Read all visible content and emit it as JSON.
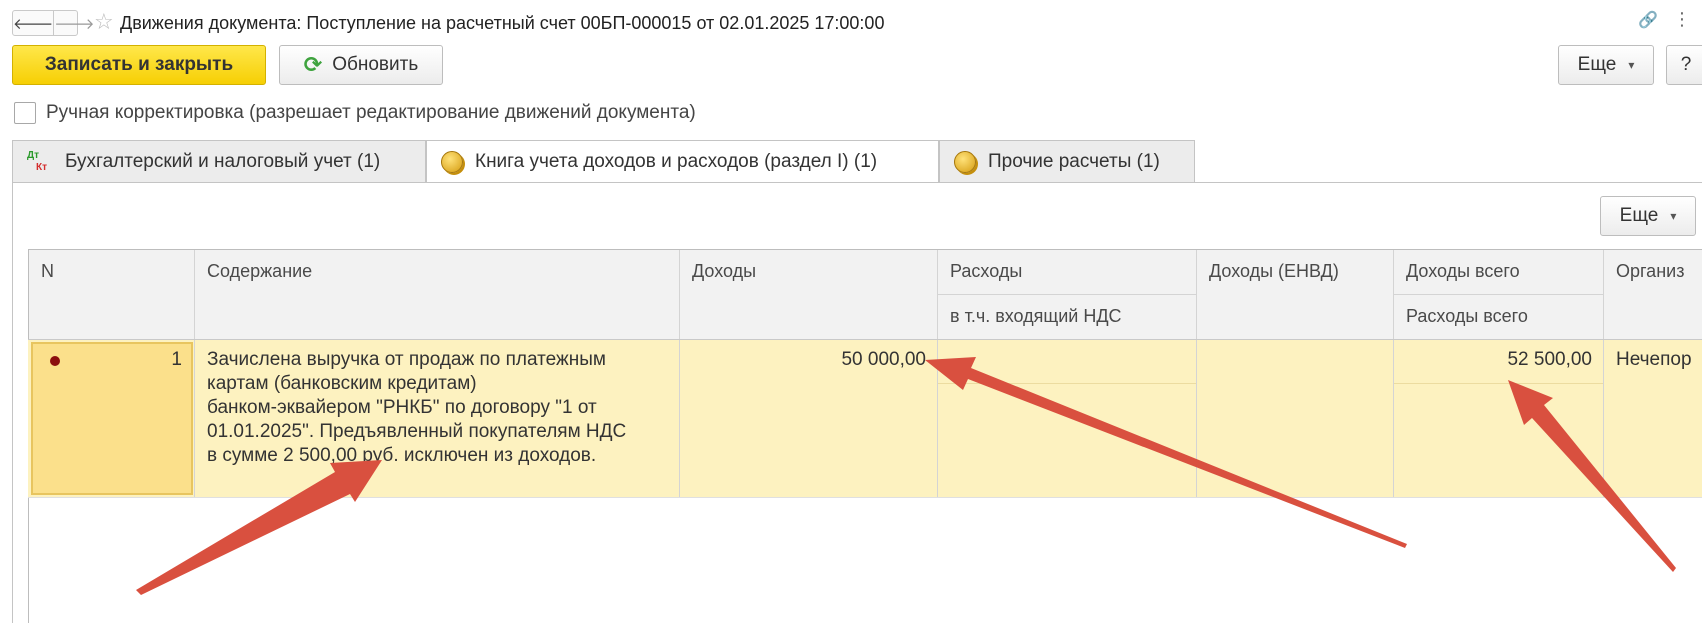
{
  "window": {
    "title": "Движения документа: Поступление на расчетный счет 00БП-000015 от 02.01.2025 17:00:00",
    "nav_back": "🡐",
    "nav_forward": "🡒",
    "icons": [
      "arrow-left-icon",
      "arrow-right-icon",
      "star-icon",
      "link-icon",
      "more-vertical-icon"
    ]
  },
  "toolbar": {
    "save_close_label": "Записать и закрыть",
    "refresh_label": "Обновить",
    "more_label": "Еще",
    "help_label": "?"
  },
  "manual_edit": {
    "label": "Ручная корректировка (разрешает редактирование движений документа)",
    "checked": false
  },
  "tabs": [
    {
      "label": "Бухгалтерский и налоговый учет (1)",
      "icon": "dt-kt-icon",
      "active": false
    },
    {
      "label": "Книга учета доходов и расходов (раздел I) (1)",
      "icon": "coins-icon",
      "active": true
    },
    {
      "label": "Прочие расчеты (1)",
      "icon": "coins-icon",
      "active": false
    }
  ],
  "tab_panel": {
    "more_label": "Еще"
  },
  "table": {
    "columns": {
      "n": "N",
      "content": "Содержание",
      "income": "Доходы",
      "expenses": "Расходы",
      "vat_incoming": "в т.ч. входящий НДС",
      "income_envd": "Доходы (ЕНВД)",
      "income_total": "Доходы всего",
      "expenses_total": "Расходы всего",
      "organization": "Организ"
    },
    "rows": [
      {
        "n": "1",
        "content": "Зачислена выручка от продаж по платежным картам (банковским кредитам) банком-эквайером \"РНКБ\" по договору \"1 от 01.01.2025\". Предъявленный покупателям НДС в сумме 2 500,00 руб. исключен из доходов.",
        "content_lines": [
          "Зачислена выручка от продаж по платежным",
          "картам (банковским кредитам)",
          "банком-эквайером \"РНКБ\" по договору \"1 от",
          "01.01.2025\". Предъявленный покупателям НДС",
          "в сумме 2 500,00 руб. исключен из доходов."
        ],
        "income": "50 000,00",
        "expenses": "",
        "vat_incoming": "",
        "income_envd": "",
        "income_total": "52 500,00",
        "expenses_total": "",
        "organization": "Нечепор"
      }
    ]
  },
  "colors": {
    "primary_button": "#f6cf04",
    "selected_row": "#fdf2c0",
    "selected_cell": "#fbe08b",
    "annotation_arrow": "#d9503f"
  }
}
